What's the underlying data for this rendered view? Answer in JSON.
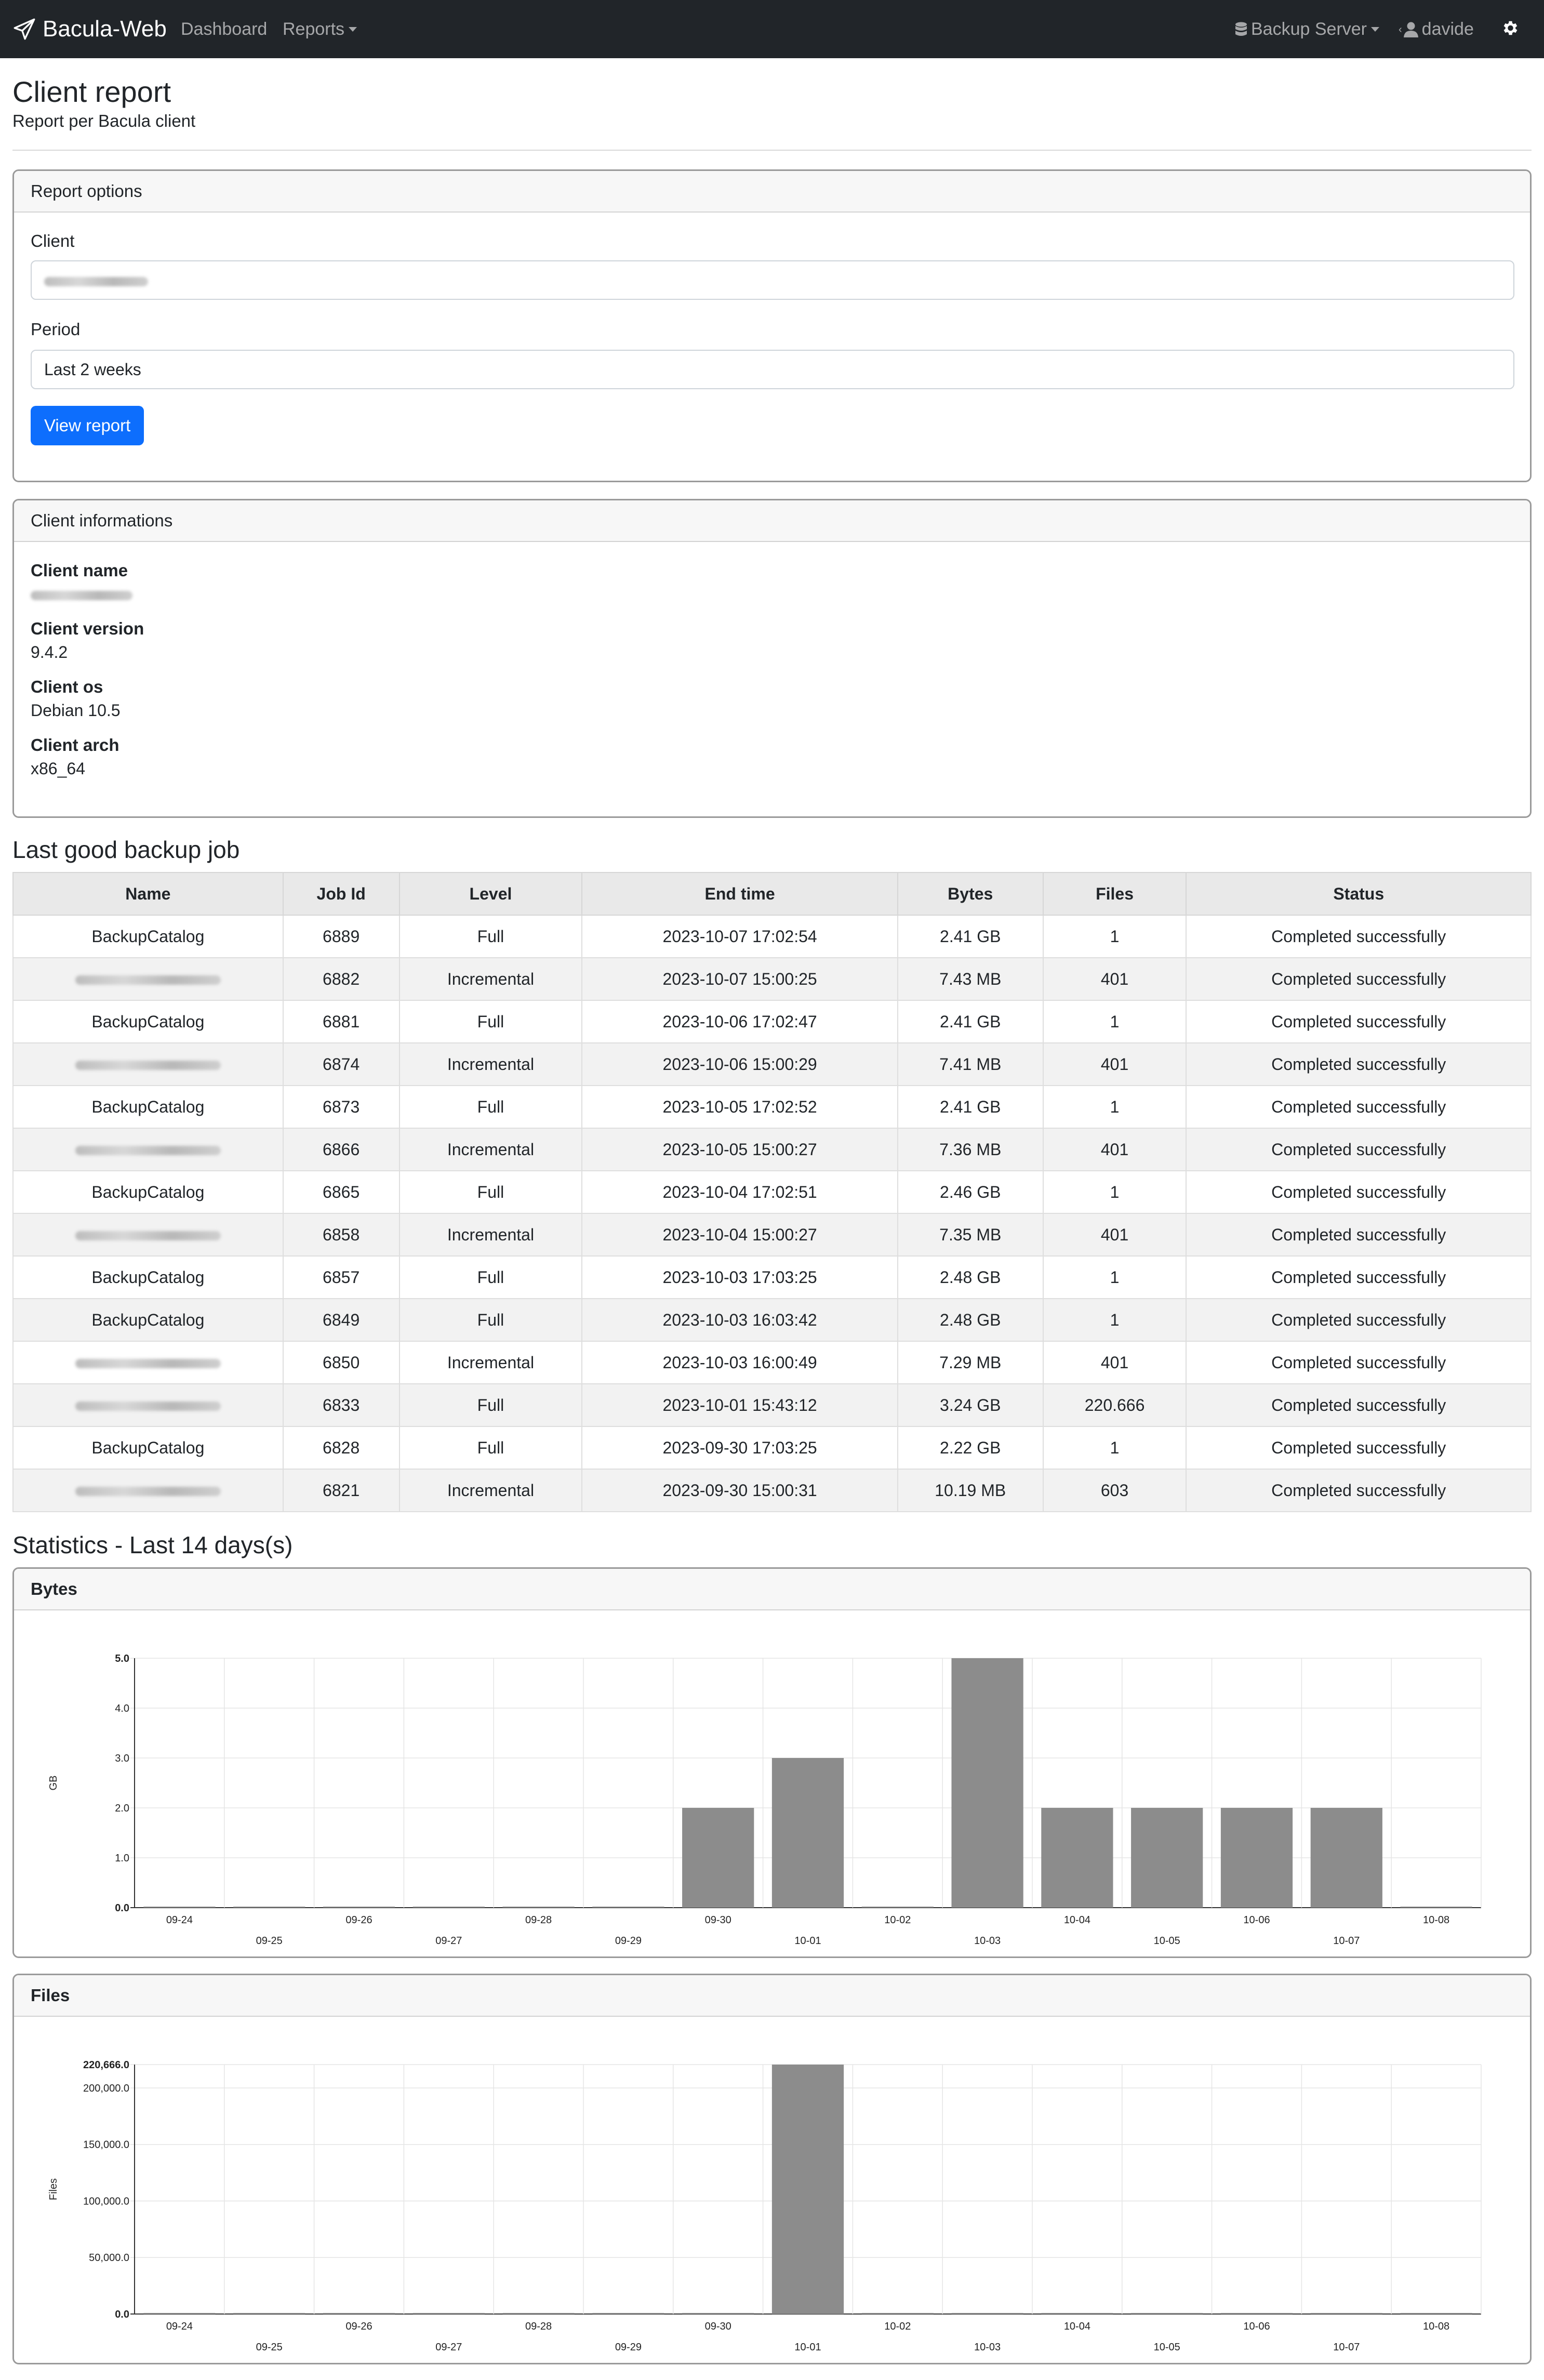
{
  "nav": {
    "brand": "Bacula-Web",
    "dashboard": "Dashboard",
    "reports": "Reports",
    "backup_server": "Backup Server",
    "user": "davide",
    "icons": [
      "paper-plane-icon",
      "database-icon",
      "user-icon",
      "gear-icon"
    ]
  },
  "header": {
    "title": "Client report",
    "subtitle": "Report per Bacula client"
  },
  "report_options": {
    "title": "Report options",
    "client_label": "Client",
    "period_label": "Period",
    "period_value": "Last 2 weeks",
    "button": "View report"
  },
  "client_info": {
    "title": "Client informations",
    "name_label": "Client name",
    "version_label": "Client version",
    "version": "9.4.2",
    "os_label": "Client os",
    "os": "Debian 10.5",
    "arch_label": "Client arch",
    "arch": "x86_64"
  },
  "last_jobs": {
    "title": "Last good backup job",
    "columns": [
      "Name",
      "Job Id",
      "Level",
      "End time",
      "Bytes",
      "Files",
      "Status"
    ],
    "rows": [
      {
        "name": "BackupCatalog",
        "blurred": false,
        "id": "6889",
        "level": "Full",
        "end": "2023-10-07 17:02:54",
        "bytes": "2.41 GB",
        "files": "1",
        "status": "Completed successfully"
      },
      {
        "name": "",
        "blurred": true,
        "id": "6882",
        "level": "Incremental",
        "end": "2023-10-07 15:00:25",
        "bytes": "7.43 MB",
        "files": "401",
        "status": "Completed successfully"
      },
      {
        "name": "BackupCatalog",
        "blurred": false,
        "id": "6881",
        "level": "Full",
        "end": "2023-10-06 17:02:47",
        "bytes": "2.41 GB",
        "files": "1",
        "status": "Completed successfully"
      },
      {
        "name": "",
        "blurred": true,
        "id": "6874",
        "level": "Incremental",
        "end": "2023-10-06 15:00:29",
        "bytes": "7.41 MB",
        "files": "401",
        "status": "Completed successfully"
      },
      {
        "name": "BackupCatalog",
        "blurred": false,
        "id": "6873",
        "level": "Full",
        "end": "2023-10-05 17:02:52",
        "bytes": "2.41 GB",
        "files": "1",
        "status": "Completed successfully"
      },
      {
        "name": "",
        "blurred": true,
        "id": "6866",
        "level": "Incremental",
        "end": "2023-10-05 15:00:27",
        "bytes": "7.36 MB",
        "files": "401",
        "status": "Completed successfully"
      },
      {
        "name": "BackupCatalog",
        "blurred": false,
        "id": "6865",
        "level": "Full",
        "end": "2023-10-04 17:02:51",
        "bytes": "2.46 GB",
        "files": "1",
        "status": "Completed successfully"
      },
      {
        "name": "",
        "blurred": true,
        "id": "6858",
        "level": "Incremental",
        "end": "2023-10-04 15:00:27",
        "bytes": "7.35 MB",
        "files": "401",
        "status": "Completed successfully"
      },
      {
        "name": "BackupCatalog",
        "blurred": false,
        "id": "6857",
        "level": "Full",
        "end": "2023-10-03 17:03:25",
        "bytes": "2.48 GB",
        "files": "1",
        "status": "Completed successfully"
      },
      {
        "name": "BackupCatalog",
        "blurred": false,
        "id": "6849",
        "level": "Full",
        "end": "2023-10-03 16:03:42",
        "bytes": "2.48 GB",
        "files": "1",
        "status": "Completed successfully"
      },
      {
        "name": "",
        "blurred": true,
        "id": "6850",
        "level": "Incremental",
        "end": "2023-10-03 16:00:49",
        "bytes": "7.29 MB",
        "files": "401",
        "status": "Completed successfully"
      },
      {
        "name": "",
        "blurred": true,
        "id": "6833",
        "level": "Full",
        "end": "2023-10-01 15:43:12",
        "bytes": "3.24 GB",
        "files": "220.666",
        "status": "Completed successfully"
      },
      {
        "name": "BackupCatalog",
        "blurred": false,
        "id": "6828",
        "level": "Full",
        "end": "2023-09-30 17:03:25",
        "bytes": "2.22 GB",
        "files": "1",
        "status": "Completed successfully"
      },
      {
        "name": "",
        "blurred": true,
        "id": "6821",
        "level": "Incremental",
        "end": "2023-09-30 15:00:31",
        "bytes": "10.19 MB",
        "files": "603",
        "status": "Completed successfully"
      }
    ]
  },
  "stats": {
    "title": "Statistics - Last 14 days(s)"
  },
  "chart_data": [
    {
      "type": "bar",
      "title": "Bytes",
      "ylabel": "GB",
      "xlabel": "",
      "categories": [
        "09-24",
        "09-25",
        "09-26",
        "09-27",
        "09-28",
        "09-29",
        "09-30",
        "10-01",
        "10-02",
        "10-03",
        "10-04",
        "10-05",
        "10-06",
        "10-07",
        "10-08"
      ],
      "values": [
        0,
        0,
        0,
        0,
        0,
        0,
        2,
        3,
        0,
        5,
        2,
        2,
        2,
        2,
        0
      ],
      "ylim": [
        0,
        5
      ],
      "yticks": [
        "0.0",
        "1.0",
        "2.0",
        "3.0",
        "4.0",
        "5.0"
      ],
      "bar_color": "#8c8c8c",
      "grid": true
    },
    {
      "type": "bar",
      "title": "Files",
      "ylabel": "Files",
      "xlabel": "",
      "categories": [
        "09-24",
        "09-25",
        "09-26",
        "09-27",
        "09-28",
        "09-29",
        "09-30",
        "10-01",
        "10-02",
        "10-03",
        "10-04",
        "10-05",
        "10-06",
        "10-07",
        "10-08"
      ],
      "values": [
        0,
        0,
        0,
        0,
        0,
        0,
        0,
        220666,
        0,
        0,
        0,
        0,
        0,
        0,
        0
      ],
      "ylim": [
        0,
        220666
      ],
      "yticks": [
        "0.0",
        "50,000.0",
        "100,000.0",
        "150,000.0",
        "200,000.0",
        "220,666.0"
      ],
      "bar_color": "#8c8c8c",
      "grid": true
    }
  ]
}
